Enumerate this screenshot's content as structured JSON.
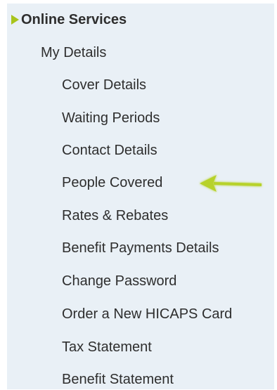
{
  "nav": {
    "header": "Online Services",
    "section": "My Details",
    "items": [
      "Cover Details",
      "Waiting Periods",
      "Contact Details",
      "People Covered",
      "Rates & Rebates",
      "Benefit Payments Details",
      "Change Password",
      "Order a New HICAPS Card",
      "Tax Statement",
      "Benefit Statement"
    ],
    "highlighted_item": "People Covered"
  },
  "colors": {
    "panel_bg": "#e9f0f6",
    "text": "#2e2e2e",
    "accent": "#a8c41c"
  },
  "icons": {
    "header_marker": "triangle-right-icon",
    "pointer": "arrow-left-icon"
  }
}
